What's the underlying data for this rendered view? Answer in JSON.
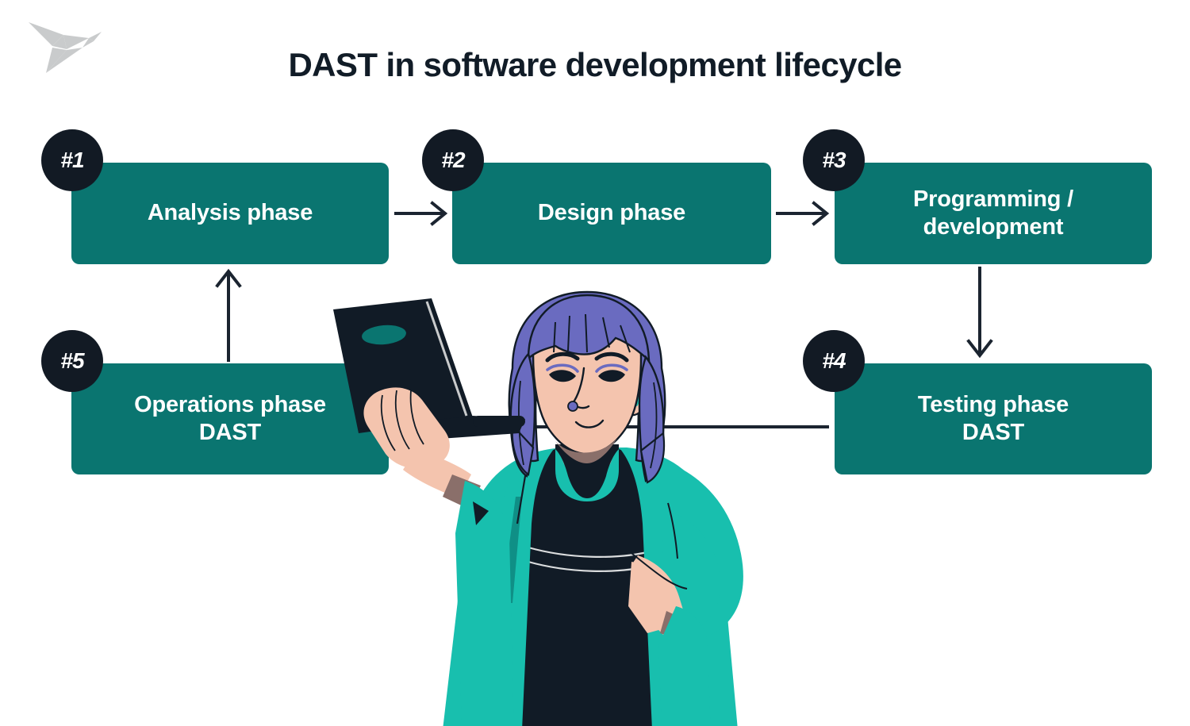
{
  "title": "DAST in software development lifecycle",
  "logo": {
    "name": "origami-bird-logo",
    "color": "#c9cbcc"
  },
  "colors": {
    "box_teal": "#0a7570",
    "badge_dark": "#121a24",
    "title_dark": "#111c27",
    "arrow_dark": "#1b2430",
    "background": "#ffffff",
    "cardigan_turquoise": "#18bfae",
    "dress_dark": "#111b26",
    "hair_purple": "#6a6bc0",
    "skin": "#f4c4ae"
  },
  "chart_data": {
    "type": "diagram",
    "title": "DAST in software development lifecycle",
    "nodes": [
      {
        "id": 1,
        "badge": "#1",
        "label": "Analysis phase"
      },
      {
        "id": 2,
        "badge": "#2",
        "label": "Design phase"
      },
      {
        "id": 3,
        "badge": "#3",
        "label": "Programming /\ndevelopment"
      },
      {
        "id": 4,
        "badge": "#4",
        "label": "Testing phase\nDAST"
      },
      {
        "id": 5,
        "badge": "#5",
        "label": "Operations phase\nDAST"
      }
    ],
    "edges": [
      {
        "from": 1,
        "to": 2,
        "direction": "right"
      },
      {
        "from": 2,
        "to": 3,
        "direction": "right"
      },
      {
        "from": 3,
        "to": 4,
        "direction": "down"
      },
      {
        "from": 4,
        "to": 5,
        "direction": "left"
      },
      {
        "from": 5,
        "to": 1,
        "direction": "up"
      }
    ]
  },
  "boxes": {
    "b1": {
      "badge": "#1",
      "label": "Analysis phase"
    },
    "b2": {
      "badge": "#2",
      "label": "Design phase"
    },
    "b3": {
      "badge": "#3",
      "label": "Programming /\ndevelopment"
    },
    "b4": {
      "badge": "#4",
      "label": "Testing phase\nDAST"
    },
    "b5": {
      "badge": "#5",
      "label": "Operations phase\nDAST"
    }
  },
  "illustration": {
    "name": "woman-holding-laptop-illustration",
    "description": "Woman with purple bob hair wearing turquoise cardigan over a dark dress, holding an open dark laptop"
  }
}
